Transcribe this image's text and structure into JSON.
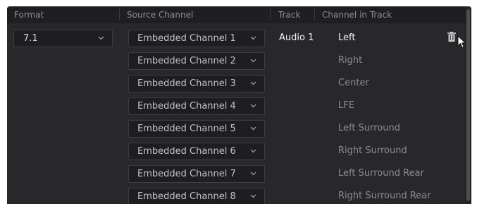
{
  "header": {
    "format": "Format",
    "source_channel": "Source Channel",
    "track": "Track",
    "channel_in_track": "Channel in Track"
  },
  "format_select": {
    "value": "7.1"
  },
  "track_value": "Audio 1",
  "rows": [
    {
      "source": "Embedded Channel 1",
      "channel": "Left"
    },
    {
      "source": "Embedded Channel 2",
      "channel": "Right"
    },
    {
      "source": "Embedded Channel 3",
      "channel": "Center"
    },
    {
      "source": "Embedded Channel 4",
      "channel": "LFE"
    },
    {
      "source": "Embedded Channel 5",
      "channel": "Left Surround"
    },
    {
      "source": "Embedded Channel 6",
      "channel": "Right Surround"
    },
    {
      "source": "Embedded Channel 7",
      "channel": "Left Surround Rear"
    },
    {
      "source": "Embedded Channel 8",
      "channel": "Right Surround Rear"
    }
  ],
  "icons": {
    "dropdown_arrow": "chevron-down-icon",
    "delete": "trash-icon",
    "cursor": "mouse-pointer-icon"
  },
  "colors": {
    "panel_bg": "#28282a",
    "header_bg": "#1f1f21",
    "dropdown_bg": "#1e1e20",
    "active_text": "#f2f2f2",
    "inactive_text": "#8c8c8c"
  }
}
